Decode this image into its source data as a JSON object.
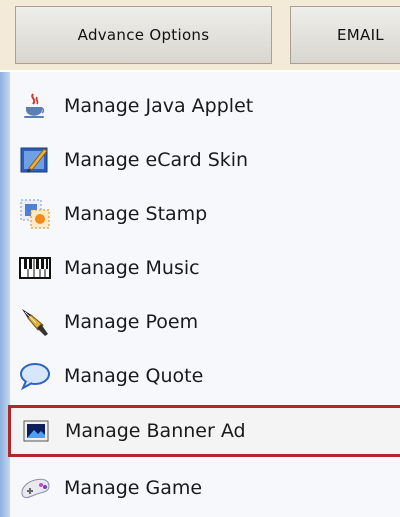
{
  "tabs": [
    {
      "label": "Advance Options"
    },
    {
      "label": "EMAIL"
    }
  ],
  "menu": {
    "items": [
      {
        "label": "Manage Java Applet",
        "icon": "java-cup-icon"
      },
      {
        "label": "Manage eCard Skin",
        "icon": "skin-brush-icon"
      },
      {
        "label": "Manage Stamp",
        "icon": "stamp-icon"
      },
      {
        "label": "Manage Music",
        "icon": "piano-keys-icon"
      },
      {
        "label": "Manage Poem",
        "icon": "fountain-pen-icon"
      },
      {
        "label": "Manage Quote",
        "icon": "speech-bubble-icon"
      },
      {
        "label": "Manage Banner Ad",
        "icon": "banner-image-icon",
        "selected": true
      },
      {
        "label": "Manage Game",
        "icon": "gamepad-icon"
      }
    ]
  },
  "colors": {
    "tabbar_bg": "#f3ead8",
    "selected_border": "#b3262a",
    "menu_edge": "#8fb2e0"
  }
}
